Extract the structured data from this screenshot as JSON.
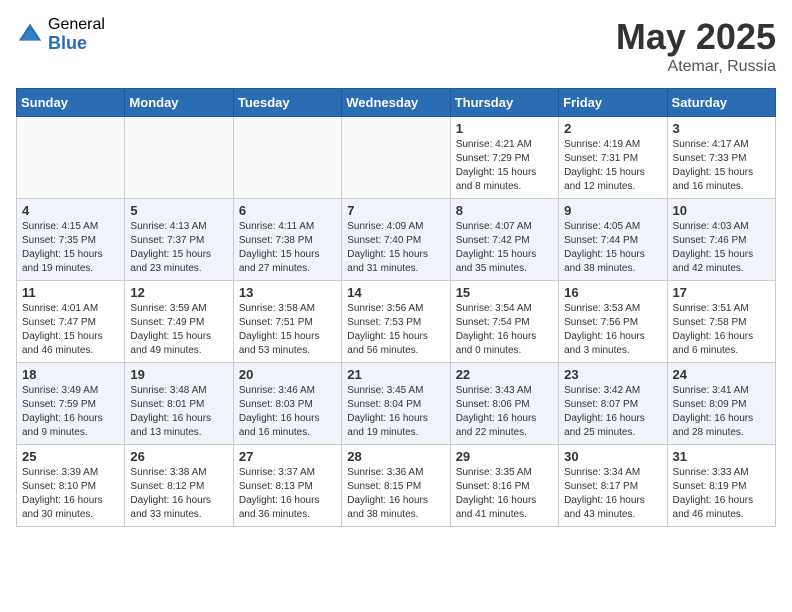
{
  "header": {
    "logo_general": "General",
    "logo_blue": "Blue",
    "title_month": "May 2025",
    "title_location": "Atemar, Russia"
  },
  "weekdays": [
    "Sunday",
    "Monday",
    "Tuesday",
    "Wednesday",
    "Thursday",
    "Friday",
    "Saturday"
  ],
  "weeks": [
    [
      {
        "day": "",
        "detail": ""
      },
      {
        "day": "",
        "detail": ""
      },
      {
        "day": "",
        "detail": ""
      },
      {
        "day": "",
        "detail": ""
      },
      {
        "day": "1",
        "detail": "Sunrise: 4:21 AM\nSunset: 7:29 PM\nDaylight: 15 hours\nand 8 minutes."
      },
      {
        "day": "2",
        "detail": "Sunrise: 4:19 AM\nSunset: 7:31 PM\nDaylight: 15 hours\nand 12 minutes."
      },
      {
        "day": "3",
        "detail": "Sunrise: 4:17 AM\nSunset: 7:33 PM\nDaylight: 15 hours\nand 16 minutes."
      }
    ],
    [
      {
        "day": "4",
        "detail": "Sunrise: 4:15 AM\nSunset: 7:35 PM\nDaylight: 15 hours\nand 19 minutes."
      },
      {
        "day": "5",
        "detail": "Sunrise: 4:13 AM\nSunset: 7:37 PM\nDaylight: 15 hours\nand 23 minutes."
      },
      {
        "day": "6",
        "detail": "Sunrise: 4:11 AM\nSunset: 7:38 PM\nDaylight: 15 hours\nand 27 minutes."
      },
      {
        "day": "7",
        "detail": "Sunrise: 4:09 AM\nSunset: 7:40 PM\nDaylight: 15 hours\nand 31 minutes."
      },
      {
        "day": "8",
        "detail": "Sunrise: 4:07 AM\nSunset: 7:42 PM\nDaylight: 15 hours\nand 35 minutes."
      },
      {
        "day": "9",
        "detail": "Sunrise: 4:05 AM\nSunset: 7:44 PM\nDaylight: 15 hours\nand 38 minutes."
      },
      {
        "day": "10",
        "detail": "Sunrise: 4:03 AM\nSunset: 7:46 PM\nDaylight: 15 hours\nand 42 minutes."
      }
    ],
    [
      {
        "day": "11",
        "detail": "Sunrise: 4:01 AM\nSunset: 7:47 PM\nDaylight: 15 hours\nand 46 minutes."
      },
      {
        "day": "12",
        "detail": "Sunrise: 3:59 AM\nSunset: 7:49 PM\nDaylight: 15 hours\nand 49 minutes."
      },
      {
        "day": "13",
        "detail": "Sunrise: 3:58 AM\nSunset: 7:51 PM\nDaylight: 15 hours\nand 53 minutes."
      },
      {
        "day": "14",
        "detail": "Sunrise: 3:56 AM\nSunset: 7:53 PM\nDaylight: 15 hours\nand 56 minutes."
      },
      {
        "day": "15",
        "detail": "Sunrise: 3:54 AM\nSunset: 7:54 PM\nDaylight: 16 hours\nand 0 minutes."
      },
      {
        "day": "16",
        "detail": "Sunrise: 3:53 AM\nSunset: 7:56 PM\nDaylight: 16 hours\nand 3 minutes."
      },
      {
        "day": "17",
        "detail": "Sunrise: 3:51 AM\nSunset: 7:58 PM\nDaylight: 16 hours\nand 6 minutes."
      }
    ],
    [
      {
        "day": "18",
        "detail": "Sunrise: 3:49 AM\nSunset: 7:59 PM\nDaylight: 16 hours\nand 9 minutes."
      },
      {
        "day": "19",
        "detail": "Sunrise: 3:48 AM\nSunset: 8:01 PM\nDaylight: 16 hours\nand 13 minutes."
      },
      {
        "day": "20",
        "detail": "Sunrise: 3:46 AM\nSunset: 8:03 PM\nDaylight: 16 hours\nand 16 minutes."
      },
      {
        "day": "21",
        "detail": "Sunrise: 3:45 AM\nSunset: 8:04 PM\nDaylight: 16 hours\nand 19 minutes."
      },
      {
        "day": "22",
        "detail": "Sunrise: 3:43 AM\nSunset: 8:06 PM\nDaylight: 16 hours\nand 22 minutes."
      },
      {
        "day": "23",
        "detail": "Sunrise: 3:42 AM\nSunset: 8:07 PM\nDaylight: 16 hours\nand 25 minutes."
      },
      {
        "day": "24",
        "detail": "Sunrise: 3:41 AM\nSunset: 8:09 PM\nDaylight: 16 hours\nand 28 minutes."
      }
    ],
    [
      {
        "day": "25",
        "detail": "Sunrise: 3:39 AM\nSunset: 8:10 PM\nDaylight: 16 hours\nand 30 minutes."
      },
      {
        "day": "26",
        "detail": "Sunrise: 3:38 AM\nSunset: 8:12 PM\nDaylight: 16 hours\nand 33 minutes."
      },
      {
        "day": "27",
        "detail": "Sunrise: 3:37 AM\nSunset: 8:13 PM\nDaylight: 16 hours\nand 36 minutes."
      },
      {
        "day": "28",
        "detail": "Sunrise: 3:36 AM\nSunset: 8:15 PM\nDaylight: 16 hours\nand 38 minutes."
      },
      {
        "day": "29",
        "detail": "Sunrise: 3:35 AM\nSunset: 8:16 PM\nDaylight: 16 hours\nand 41 minutes."
      },
      {
        "day": "30",
        "detail": "Sunrise: 3:34 AM\nSunset: 8:17 PM\nDaylight: 16 hours\nand 43 minutes."
      },
      {
        "day": "31",
        "detail": "Sunrise: 3:33 AM\nSunset: 8:19 PM\nDaylight: 16 hours\nand 46 minutes."
      }
    ]
  ]
}
